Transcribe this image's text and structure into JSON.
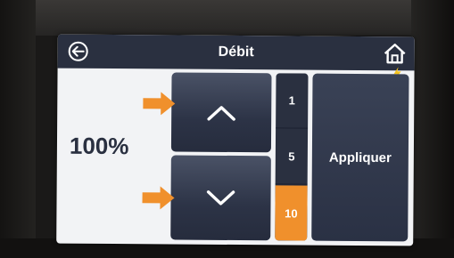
{
  "header": {
    "title": "Débit",
    "back_icon": "back-arrow-circle-icon",
    "home_icon": "home-icon"
  },
  "main": {
    "value_display": "100%",
    "up_icon": "chevron-up-icon",
    "down_icon": "chevron-down-icon",
    "steps": [
      {
        "label": "1",
        "selected": false
      },
      {
        "label": "5",
        "selected": false
      },
      {
        "label": "10",
        "selected": true
      }
    ],
    "apply_label": "Appliquer"
  },
  "colors": {
    "header_bg": "#2a3040",
    "button_bg": "#2c3346",
    "accent": "#f0902c",
    "screen_bg": "#f2f3f5"
  }
}
